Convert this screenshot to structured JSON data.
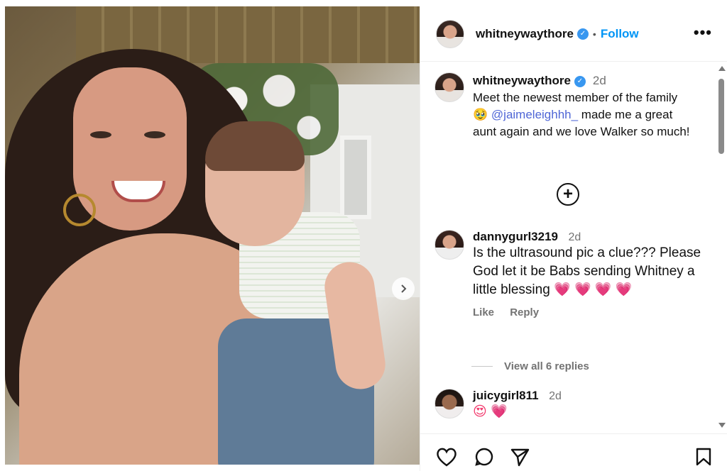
{
  "post": {
    "author": "whitneywaythore",
    "follow_label": "Follow",
    "dot": "•",
    "more": "•••"
  },
  "caption": {
    "user": "whitneywaythore",
    "time": "2d",
    "line1": "Meet the newest member of the family",
    "emoji": "🥹",
    "mention": "@jaimeleighhh_",
    "rest": " made me a great aunt again and we love Walker so much!"
  },
  "comments": [
    {
      "user": "dannygurl3219",
      "time": "2d",
      "text": "Is the ultrasound pic a clue??? Please God let it be Babs sending Whitney a little blessing",
      "emoji": "💗 💗 💗 💗",
      "like": "Like",
      "reply": "Reply",
      "view_replies": "View all 6 replies"
    },
    {
      "user": "juicygirl811",
      "time": "2d",
      "emoji": "😍 💗"
    }
  ],
  "icons": {
    "next": "chevron-right-icon",
    "add": "plus-circle-icon",
    "like": "heart-icon",
    "comment": "comment-icon",
    "share": "send-icon",
    "save": "bookmark-icon",
    "verified": "verified-icon"
  },
  "colors": {
    "accent": "#0095f6",
    "verified": "#3897f0",
    "mention": "#4f66d6",
    "muted": "#737373"
  }
}
